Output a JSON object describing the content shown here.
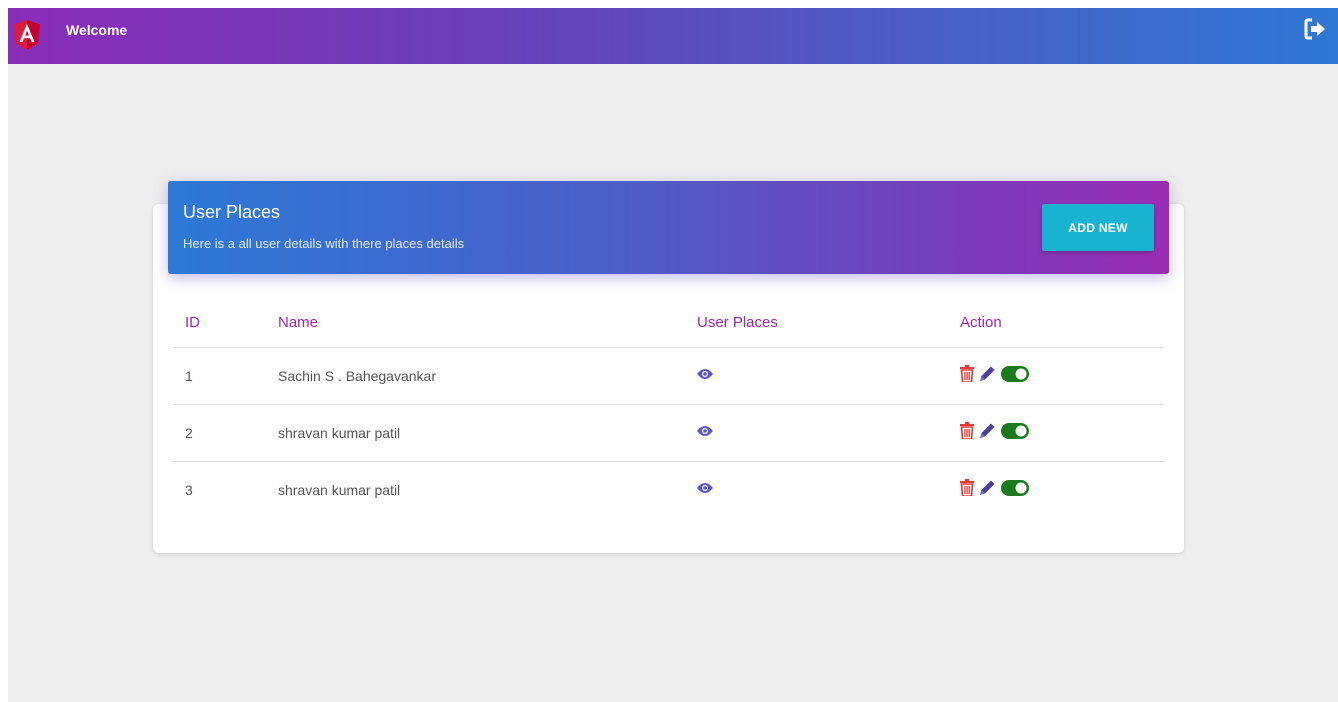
{
  "navbar": {
    "title": "Welcome",
    "logo_icon": "angular-logo",
    "logout_icon": "sign-out-icon"
  },
  "card": {
    "title": "User Places",
    "subtitle": "Here is a all user details with there places details",
    "add_button_label": "ADD NEW"
  },
  "table": {
    "headers": [
      "ID",
      "Name",
      "User Places",
      "Action"
    ],
    "rows": [
      {
        "id": "1",
        "name": "Sachin S . Bahegavankar"
      },
      {
        "id": "2",
        "name": "shravan kumar patil"
      },
      {
        "id": "3",
        "name": "shravan kumar patil"
      }
    ]
  },
  "colors": {
    "header_text": "#9c27b0",
    "view_icon": "#5e55c9",
    "delete_icon": "#e53935",
    "edit_icon": "#4a3f9a",
    "toggle_icon": "#1b7a1b",
    "add_button": "#19b3cf"
  }
}
